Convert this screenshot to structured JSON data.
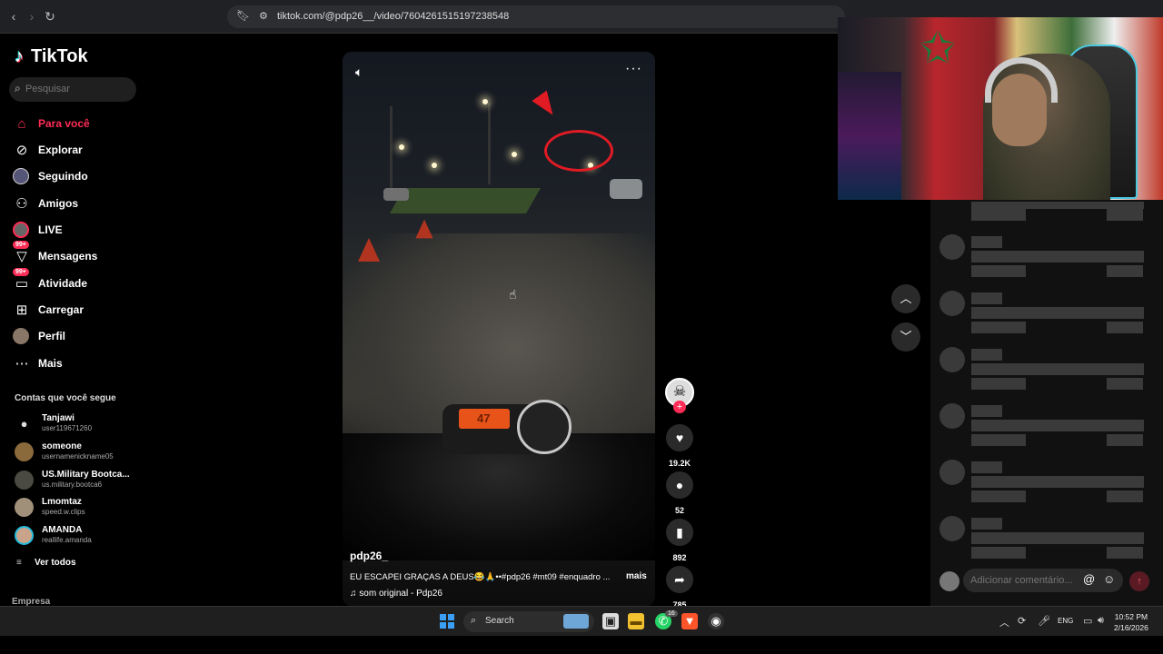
{
  "browser": {
    "url": "tiktok.com/@pdp26__/video/7604261515197238548"
  },
  "sidebar": {
    "logo": "TikTok",
    "search_placeholder": "Pesquisar",
    "nav": [
      {
        "label": "Para você",
        "icon": "home-icon"
      },
      {
        "label": "Explorar",
        "icon": "compass-icon"
      },
      {
        "label": "Seguindo",
        "icon": "avatar-icon"
      },
      {
        "label": "Amigos",
        "icon": "friends-icon"
      },
      {
        "label": "LIVE",
        "icon": "live-icon"
      },
      {
        "label": "Mensagens",
        "icon": "message-icon",
        "badge": "99+"
      },
      {
        "label": "Atividade",
        "icon": "activity-icon",
        "badge": "99+"
      },
      {
        "label": "Carregar",
        "icon": "upload-icon"
      },
      {
        "label": "Perfil",
        "icon": "profile-icon"
      },
      {
        "label": "Mais",
        "icon": "more-icon"
      }
    ],
    "following_title": "Contas que você segue",
    "accounts": [
      {
        "name": "Tanjawi",
        "handle": "user119671260"
      },
      {
        "name": "someone",
        "handle": "usernamenickname05"
      },
      {
        "name": "US.Military Bootca...",
        "handle": "us.military.bootca6"
      },
      {
        "name": "Lmomtaz",
        "handle": "speed.w.clips"
      },
      {
        "name": "AMANDA",
        "handle": "reallife.amanda"
      }
    ],
    "see_all": "Ver todos",
    "company": "Empresa"
  },
  "video": {
    "author": "pdp26_",
    "caption": "EU ESCAPEI GRAÇAS A DEUS😂🙏••#pdp26 #mt09 #enquadro ...",
    "more": "mais",
    "sound": "som original - Pdp26",
    "speedo": "47"
  },
  "actions": {
    "likes": "19.2K",
    "comments": "52",
    "saves": "892",
    "shares": "785"
  },
  "comment_box": {
    "placeholder": "Adicionar comentário..."
  },
  "taskbar": {
    "search": "Search",
    "lang": "ENG",
    "time": "10:52 PM",
    "date": "2/16/2026",
    "whatsapp_badge": "16"
  },
  "colors": {
    "accent": "#fe2c55",
    "background": "#000000",
    "highlight_circle": "#e01b24"
  }
}
